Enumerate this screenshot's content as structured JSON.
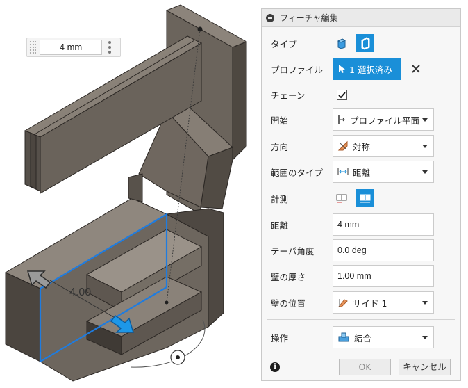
{
  "viewport": {
    "distance_value": "4 mm",
    "dimension_text": "4.00"
  },
  "dialog": {
    "title": "フィーチャ編集",
    "type_label": "タイプ",
    "profile_label": "プロファイル",
    "profile_selected": "1 選択済み",
    "chain_label": "チェーン",
    "chain_checked": true,
    "start_label": "開始",
    "start_value": "プロファイル平面",
    "direction_label": "方向",
    "direction_value": "対称",
    "extent_type_label": "範囲のタイプ",
    "extent_type_value": "距離",
    "measure_label": "計測",
    "distance_label": "距離",
    "distance_value": "4 mm",
    "taper_label": "テーパ角度",
    "taper_value": "0.0 deg",
    "wall_thickness_label": "壁の厚さ",
    "wall_thickness_value": "1.00 mm",
    "wall_position_label": "壁の位置",
    "wall_position_value": "サイド 1",
    "operation_label": "操作",
    "operation_value": "結合",
    "ok_label": "OK",
    "cancel_label": "キャンセル"
  },
  "colors": {
    "accent": "#1a8fd8",
    "model_face_dark": "#5a534c",
    "model_face_mid": "#7a726a",
    "model_face_light": "#8f877e",
    "selection_edge": "#1e7ce0"
  }
}
